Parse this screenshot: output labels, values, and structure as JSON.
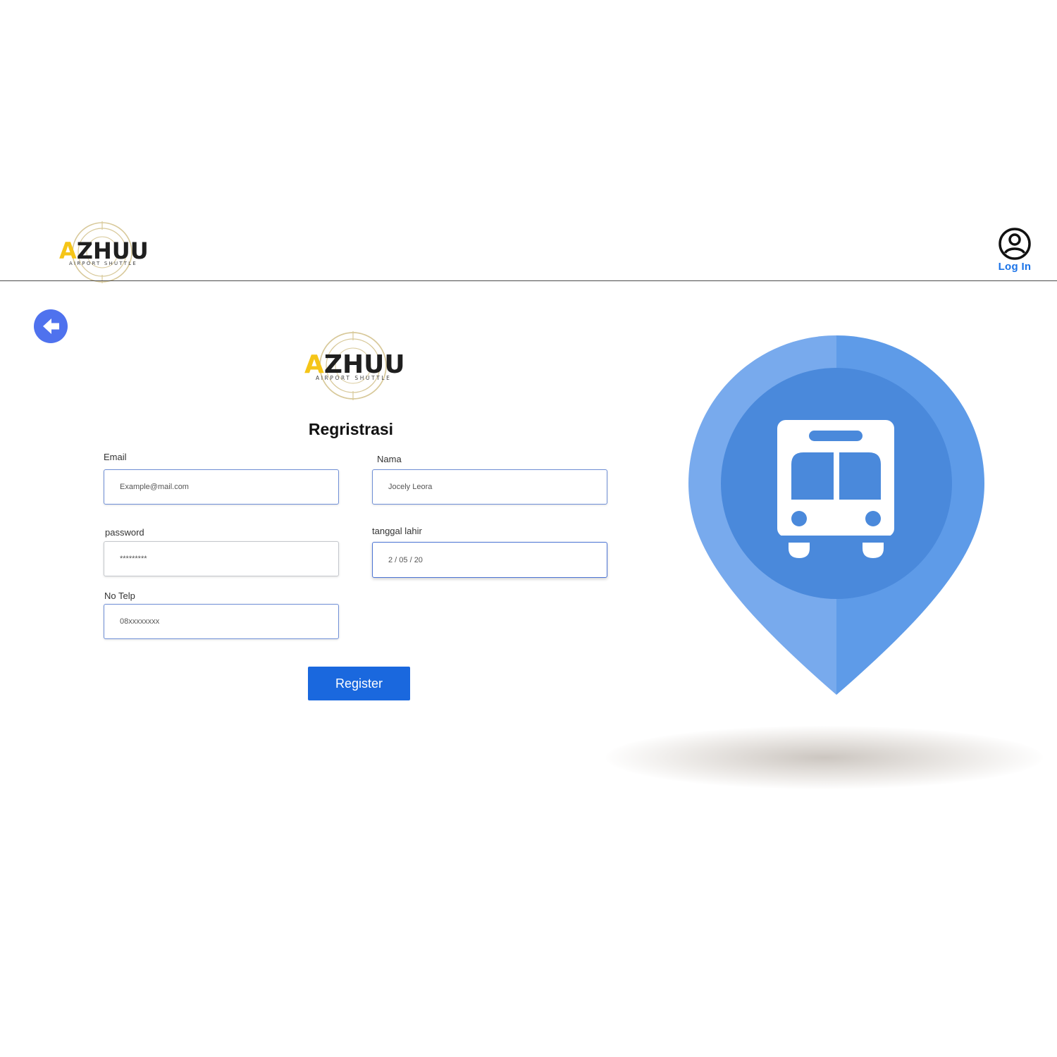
{
  "brand": {
    "logo_text": "AZHUU",
    "logo_initial": "A",
    "logo_rest": "ZHUU",
    "tagline": "AIRPORT SHUTTLE",
    "accent_color": "#f5c518",
    "ring_color": "#d8c99a"
  },
  "header": {
    "login_label": "Log In",
    "login_icon": "user-circle-icon"
  },
  "back": {
    "icon": "arrow-left-icon",
    "color": "#4f72ee"
  },
  "form": {
    "title": "Regristrasi",
    "fields": {
      "email": {
        "label": "Email",
        "placeholder": "Example@mail.com"
      },
      "nama": {
        "label": "Nama",
        "placeholder": "Jocely Leora"
      },
      "password": {
        "label": "password",
        "placeholder": "*********"
      },
      "tanggal_lahir": {
        "label": "tanggal lahir",
        "placeholder": "2 / 05 / 20"
      },
      "no_telp": {
        "label": "No Telp",
        "placeholder": "08xxxxxxxx"
      }
    },
    "submit_label": "Register",
    "primary_color": "#1a68de"
  },
  "illustration": {
    "icon": "bus-location-pin-icon",
    "pin_light": "#78aaed",
    "pin_mid": "#5e9be8",
    "pin_inner": "#4a89db"
  }
}
